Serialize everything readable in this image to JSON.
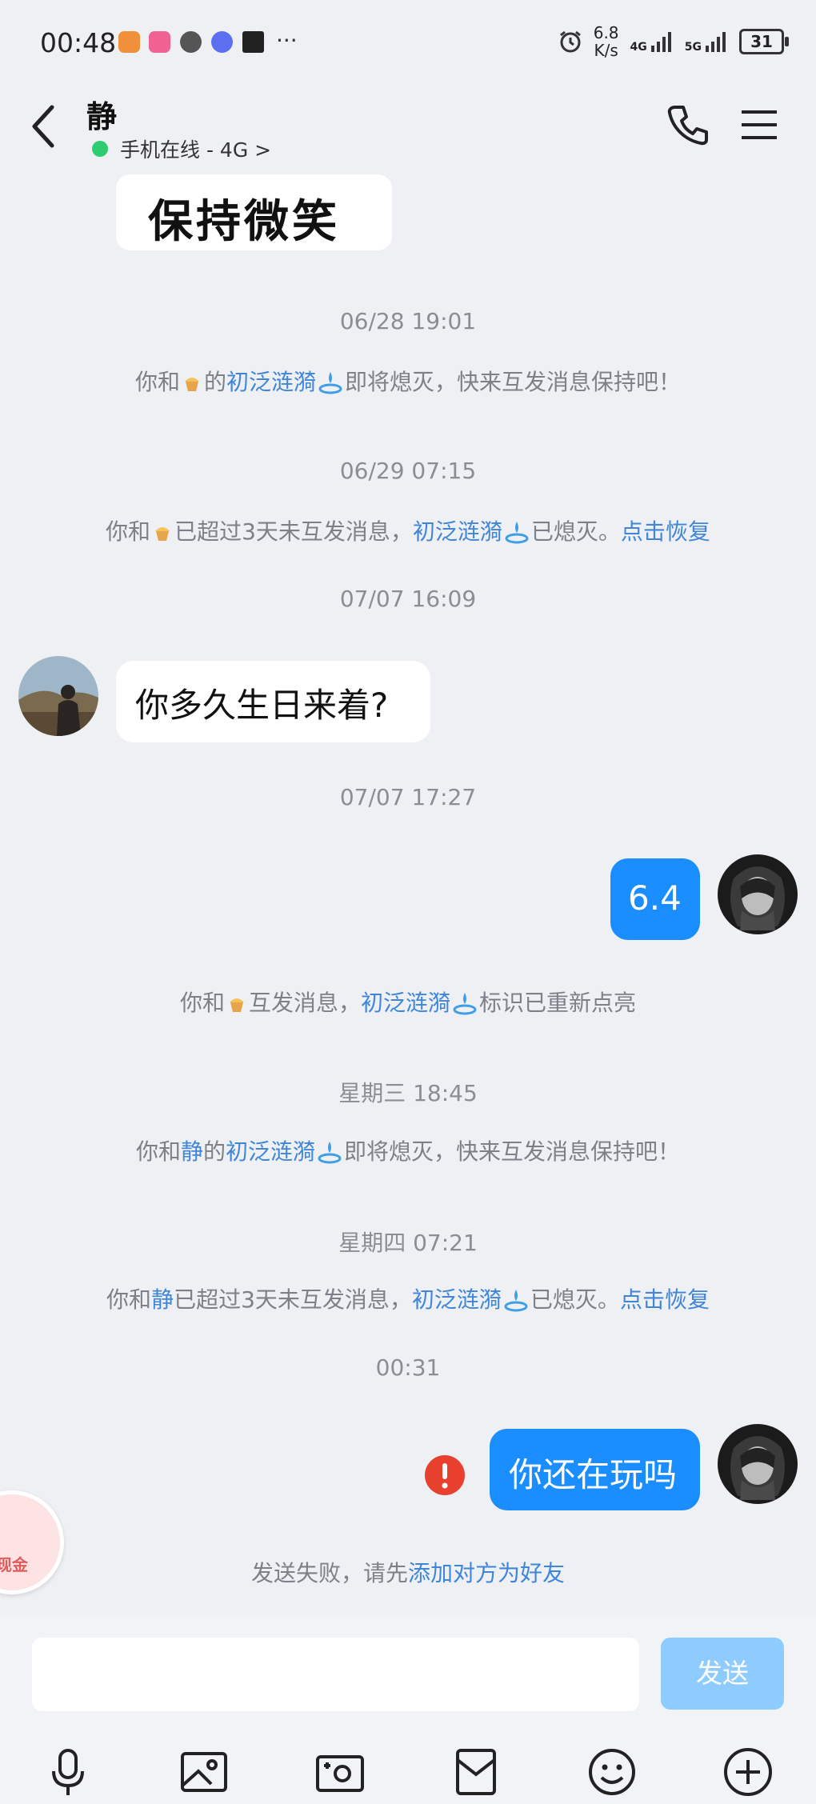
{
  "status_bar": {
    "time": "00:48",
    "net_speed_value": "6.8",
    "net_speed_unit": "K/s",
    "signal_1": "4G",
    "signal_2": "5G",
    "battery": "31",
    "more": "···",
    "app_icon_colors": [
      "#f0903a",
      "#f06292",
      "#555555",
      "#5b6ff0",
      "#222222"
    ]
  },
  "header": {
    "contact_name": "静",
    "online_status": "手机在线 - 4G >",
    "online_color": "#2ecc71"
  },
  "messages": {
    "sticker_text": "保持微笑",
    "ts_1": "06/28 19:01",
    "sys_1": {
      "pre": "你和",
      "mid": "的",
      "spark": "初泛涟漪",
      "post": "即将熄灭，快来互发消息保持吧！"
    },
    "ts_2": "06/29 07:15",
    "sys_2": {
      "pre": "你和",
      "mid": "已超过3天未互发消息，",
      "spark": "初泛涟漪",
      "post": "已熄灭。",
      "action": "点击恢复"
    },
    "ts_3": "07/07 16:09",
    "incoming_1": "你多久生日来着?",
    "ts_4": "07/07 17:27",
    "outgoing_1": "6.4",
    "sys_3": {
      "pre": "你和",
      "mid": "互发消息，",
      "spark": "初泛涟漪",
      "post": "标识已重新点亮"
    },
    "ts_5": "星期三 18:45",
    "sys_4": {
      "pre": "你和",
      "name": "静",
      "mid": "的",
      "spark": "初泛涟漪",
      "post": "即将熄灭，快来互发消息保持吧！"
    },
    "ts_6": "星期四 07:21",
    "sys_5": {
      "pre": "你和",
      "name": "静",
      "mid": "已超过3天未互发消息，",
      "spark": "初泛涟漪",
      "post": "已熄灭。",
      "action": "点击恢复"
    },
    "ts_7": "00:31",
    "outgoing_2": "你还在玩吗",
    "failed_text": "发送失败，请先",
    "failed_action": "添加对方为好友",
    "floating_badge": "现金"
  },
  "input": {
    "placeholder": "",
    "send_label": "发送"
  },
  "toolbar": {
    "icons": [
      "microphone-icon",
      "image-icon",
      "camera-icon",
      "red-packet-icon",
      "emoji-icon",
      "plus-icon"
    ]
  },
  "colors": {
    "accent": "#1a8dff",
    "link": "#3f86d9",
    "error": "#e8402e",
    "send_disabled": "#8ecbff"
  }
}
